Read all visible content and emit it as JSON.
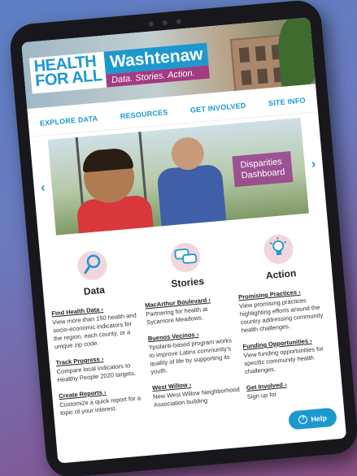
{
  "logo": {
    "health": "HEALTH",
    "forall": "FOR ALL",
    "washtenaw": "Washtenaw",
    "tagline": "Data. Stories. Action."
  },
  "nav": [
    "EXPLORE DATA",
    "RESOURCES",
    "GET INVOLVED",
    "SITE INFO"
  ],
  "carousel": {
    "badge_line1": "Disparities",
    "badge_line2": "Dashboard",
    "prev": "‹",
    "next": "›"
  },
  "columns": [
    {
      "title": "Data",
      "icon": "magnifier-icon",
      "items": [
        {
          "link": "Find Health Data",
          "text": "View more than 150 health and socio-economic indicators for the region, each county, or a unique zip code."
        },
        {
          "link": "Track Progress",
          "text": "Compare local indicators to Healthy People 2020 targets."
        },
        {
          "link": "Create Reports",
          "text": "Customize a quick report for a topic of your interest."
        }
      ]
    },
    {
      "title": "Stories",
      "icon": "chat-bubbles-icon",
      "items": [
        {
          "link": "MacArthur Boulevard",
          "text": "Partnering for health at Sycamore Meadows."
        },
        {
          "link": "Buenos Vecinos",
          "text": "Ypsilanti-based program works to improve Latinx community's quality of life by supporting its youth."
        },
        {
          "link": "West Willow",
          "text": "New West Willow Neighborhood Association building"
        }
      ]
    },
    {
      "title": "Action",
      "icon": "lightbulb-icon",
      "items": [
        {
          "link": "Promising Practices",
          "text": "View promising practices highlighting efforts around the country addressing community health challenges."
        },
        {
          "link": "Funding Opportunities",
          "text": "View funding opportunities for specific community health challenges."
        },
        {
          "link": "Get Involved",
          "text": "Sign up for"
        }
      ]
    }
  ],
  "help_label": "Help"
}
